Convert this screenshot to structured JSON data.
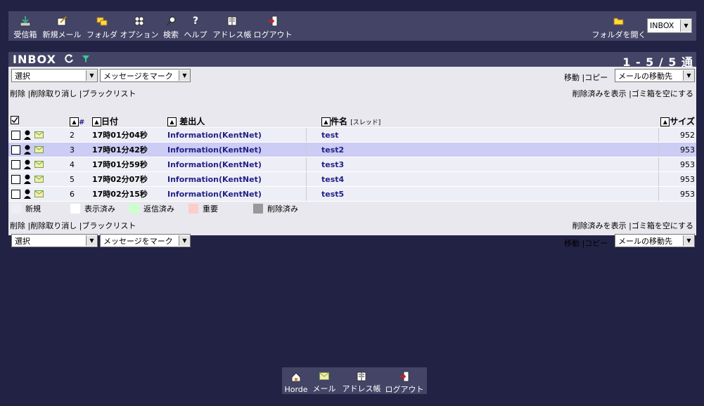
{
  "toolbar": {
    "items": [
      {
        "label": "受信箱",
        "icon": "inbox-download-icon"
      },
      {
        "label": "新規メール",
        "icon": "compose-icon"
      },
      {
        "label": "フォルダ",
        "icon": "folders-icon"
      },
      {
        "label": "オプション",
        "icon": "options-icon"
      },
      {
        "label": "検索",
        "icon": "search-icon"
      },
      {
        "label": "ヘルプ",
        "icon": "help-icon"
      },
      {
        "label": "アドレス帳",
        "icon": "addressbook-icon"
      },
      {
        "label": "ログアウト",
        "icon": "logout-icon"
      }
    ],
    "open_folder_label": "フォルダを開く",
    "folder_select_value": "INBOX"
  },
  "mailbox": {
    "title": "INBOX",
    "count": "1 - 5 / 5 通"
  },
  "controls": {
    "select_value": "選択",
    "mark_value": "メッセージをマーク",
    "move_label": "移動",
    "copy_label": "コピー",
    "move_target_value": "メールの移動先",
    "delete_label": "削除",
    "undelete_label": "削除取り消し",
    "blacklist_label": "ブラックリスト",
    "show_deleted_label": "削除済みを表示",
    "empty_trash_label": "ゴミ箱を空にする",
    "separator": "|"
  },
  "columns": {
    "num": "#",
    "date": "日付",
    "from": "差出人",
    "subject": "件名",
    "thread": "[スレッド]",
    "size": "サイズ"
  },
  "messages": [
    {
      "num": "2",
      "date": "17時01分04秒",
      "from": "Information(KentNet)",
      "subject": "test",
      "size": "952"
    },
    {
      "num": "3",
      "date": "17時01分42秒",
      "from": "Information(KentNet)",
      "subject": "test2",
      "size": "953"
    },
    {
      "num": "4",
      "date": "17時01分59秒",
      "from": "Information(KentNet)",
      "subject": "test3",
      "size": "953"
    },
    {
      "num": "5",
      "date": "17時02分07秒",
      "from": "Information(KentNet)",
      "subject": "test4",
      "size": "953"
    },
    {
      "num": "6",
      "date": "17時02分15秒",
      "from": "Information(KentNet)",
      "subject": "test5",
      "size": "953"
    }
  ],
  "legend": [
    {
      "label": "新規",
      "color": "#eeeef6"
    },
    {
      "label": "表示済み",
      "color": "#ffffff"
    },
    {
      "label": "返信済み",
      "color": "#ccffcc"
    },
    {
      "label": "重要",
      "color": "#ffcccc"
    },
    {
      "label": "削除済み",
      "color": "#999999"
    }
  ],
  "bottom_nav": [
    {
      "label": "Horde",
      "icon": "home-icon"
    },
    {
      "label": "メール",
      "icon": "mail-icon"
    },
    {
      "label": "アドレス帳",
      "icon": "addressbook-icon"
    },
    {
      "label": "ログアウト",
      "icon": "logout-icon"
    }
  ],
  "colors": {
    "background": "#222244",
    "bar": "#444466",
    "selected_row": "#ccccf4",
    "link": "#222288"
  }
}
